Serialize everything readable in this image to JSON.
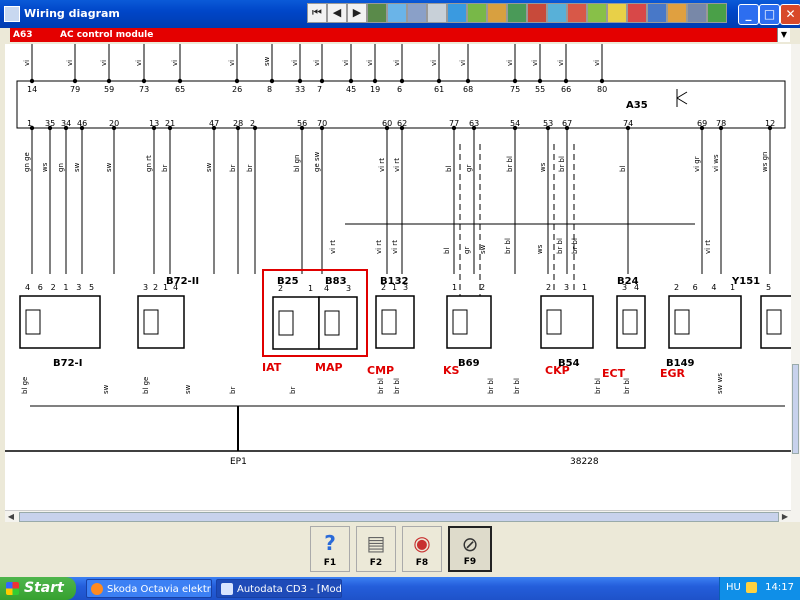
{
  "window": {
    "title": "Wiring diagram"
  },
  "toolbar": {
    "nav_first": "⏮",
    "nav_prev": "◀",
    "nav_next": "▶",
    "nav_last": "⏭"
  },
  "window_controls": {
    "minimize": "_",
    "maximize": "□",
    "close": "✕"
  },
  "module_selector": {
    "code": "A63",
    "name": "AC control module"
  },
  "diagram": {
    "top_pins": [
      "14",
      "79",
      "59",
      "73",
      "65",
      "26",
      "8",
      "33",
      "7",
      "45",
      "19",
      "6",
      "61",
      "68",
      "75",
      "55",
      "66",
      "80"
    ],
    "top_wire_colors": [
      "vi",
      "vi",
      "vi",
      "vi",
      "vi",
      "vi",
      "sw",
      "vi",
      "vi",
      "vi",
      "vi",
      "vi",
      "vi",
      "vi",
      "vi",
      "vi",
      "vi",
      "vi"
    ],
    "module_label": "A35",
    "bottom_pins": [
      "1",
      "35",
      "34",
      "46",
      "20",
      "13",
      "21",
      "47",
      "28",
      "2",
      "56",
      "70",
      "60",
      "62",
      "77",
      "63",
      "54",
      "53",
      "67",
      "74",
      "69",
      "78",
      "12"
    ],
    "bottom_wire_colors": [
      "gn ge",
      "ws",
      "gn",
      "sw",
      "sw",
      "gn rt",
      "br",
      "sw",
      "br",
      "br",
      "bl gn",
      "ge sw",
      "vi rt",
      "vi rt",
      "bl",
      "gr",
      "br bl",
      "ws",
      "br bl",
      "bl",
      "vi gr",
      "vi ws",
      "ws gn"
    ],
    "mid_wire_colors": [
      "vi rt",
      "vi rt",
      "vi rt",
      "bl",
      "gr",
      "sw",
      "br bl",
      "ws",
      "br bl",
      "br bl",
      "vi rt"
    ],
    "lower_wire_colors": [
      "bl ge",
      "sw",
      "bl ge",
      "sw",
      "br",
      "br",
      "br bl",
      "br bl",
      "br bl",
      "br bl",
      "br bl",
      "br bl",
      "sw ws"
    ],
    "components": [
      {
        "id": "B72-I",
        "pins": [
          "4",
          "6",
          "2",
          "1",
          "3",
          "5"
        ]
      },
      {
        "id": "B72-II",
        "pins": [
          "3",
          "2",
          "1",
          "4"
        ]
      },
      {
        "id": "B25",
        "pins": [
          "2",
          "1"
        ]
      },
      {
        "id": "B83",
        "pins": [
          "4",
          "3"
        ]
      },
      {
        "id": "B132",
        "pins": [
          "2",
          "1",
          "3"
        ]
      },
      {
        "id": "B69",
        "pins": [
          "1",
          "2"
        ]
      },
      {
        "id": "B54",
        "pins": [
          "2",
          "3",
          "1"
        ]
      },
      {
        "id": "B24",
        "pins": [
          "3",
          "4"
        ]
      },
      {
        "id": "B149",
        "pins": [
          "2",
          "6",
          "4",
          "1"
        ]
      },
      {
        "id": "Y151",
        "pins": [
          "5"
        ]
      }
    ],
    "sensor_labels": [
      "IAT",
      "MAP",
      "CMP",
      "KS",
      "CKP",
      "ECT",
      "EGR"
    ],
    "ground_label": "EP1",
    "ground_ref": "38228",
    "colors": {
      "wire": "#000000",
      "label_red": "#e00000",
      "highlight": "#e00000"
    }
  },
  "function_keys": [
    {
      "label": "F1",
      "icon": "help-icon"
    },
    {
      "label": "F2",
      "icon": "printer-icon"
    },
    {
      "label": "F8",
      "icon": "magnify-icon"
    },
    {
      "label": "F9",
      "icon": "probe-icon"
    }
  ],
  "taskbar": {
    "start_label": "Start",
    "tasks": [
      "Skoda Octavia elektr...",
      "Autodata CD3 - [Mod..."
    ],
    "language": "HU",
    "clock": "14:17"
  }
}
